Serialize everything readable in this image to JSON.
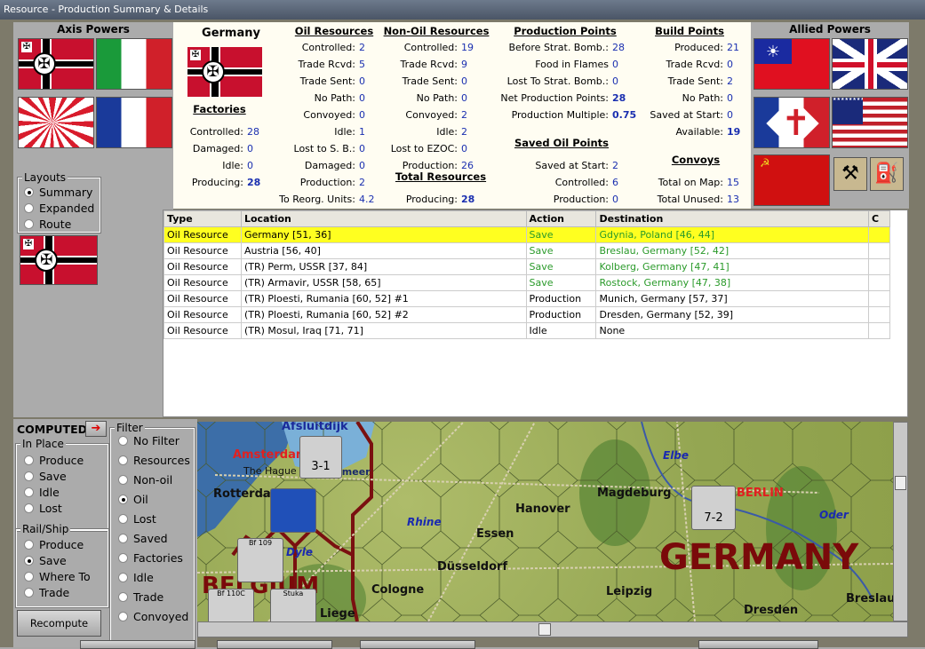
{
  "window": {
    "title": "Resource - Production Summary & Details"
  },
  "axis": {
    "title": "Axis Powers",
    "flags": [
      "germany",
      "italy",
      "japan",
      "vichy-france"
    ]
  },
  "allied": {
    "title": "Allied Powers",
    "flags": [
      "china",
      "united-kingdom",
      "free-france",
      "usa",
      "ussr",
      "resource-icons"
    ]
  },
  "layouts": {
    "title": "Layouts",
    "options": [
      "Summary",
      "Expanded",
      "Route"
    ],
    "selected": 0
  },
  "country": {
    "name": "Germany"
  },
  "stats": {
    "factories": {
      "header": "Factories",
      "items": [
        [
          "Controlled:",
          "28"
        ],
        [
          "Damaged:",
          "0"
        ],
        [
          "Idle:",
          "0"
        ],
        [
          "Producing:",
          "28"
        ]
      ]
    },
    "oil": {
      "header": "Oil Resources",
      "items": [
        [
          "Controlled:",
          "2"
        ],
        [
          "Trade Rcvd:",
          "5"
        ],
        [
          "Trade Sent:",
          "0"
        ],
        [
          "No Path:",
          "0"
        ],
        [
          "Convoyed:",
          "0"
        ],
        [
          "Idle:",
          "1"
        ],
        [
          "Lost to S. B.:",
          "0"
        ],
        [
          "Damaged:",
          "0"
        ],
        [
          "Production:",
          "2"
        ],
        [
          "To Reorg. Units:",
          "4.2"
        ]
      ]
    },
    "nonoil": {
      "header": "Non-Oil Resources",
      "items": [
        [
          "Controlled:",
          "19"
        ],
        [
          "Trade Rcvd:",
          "9"
        ],
        [
          "Trade Sent:",
          "0"
        ],
        [
          "No Path:",
          "0"
        ],
        [
          "Convoyed:",
          "2"
        ],
        [
          "Idle:",
          "2"
        ],
        [
          "Lost to EZOC:",
          "0"
        ],
        [
          "Production:",
          "26"
        ]
      ]
    },
    "total": {
      "header": "Total Resources",
      "items": [
        [
          "Producing:",
          "28"
        ]
      ]
    },
    "production": {
      "header": "Production Points",
      "items": [
        [
          "Before Strat. Bomb.:",
          "28"
        ],
        [
          "Food in Flames",
          "0"
        ],
        [
          "Lost To Strat. Bomb.:",
          "0"
        ],
        [
          "Net Production Points:",
          "28"
        ],
        [
          "Production Multiple:",
          "0.75"
        ]
      ]
    },
    "savedoil": {
      "header": "Saved Oil Points",
      "items": [
        [
          "Saved at Start:",
          "2"
        ],
        [
          "Controlled:",
          "6"
        ],
        [
          "Production:",
          "0"
        ]
      ]
    },
    "build": {
      "header": "Build Points",
      "items": [
        [
          "Produced:",
          "21"
        ],
        [
          "Trade Rcvd:",
          "0"
        ],
        [
          "Trade Sent:",
          "2"
        ],
        [
          "No Path:",
          "0"
        ],
        [
          "Saved at Start:",
          "0"
        ],
        [
          "Available:",
          "19"
        ]
      ]
    },
    "convoys": {
      "header": "Convoys",
      "items": [
        [
          "Total on Map:",
          "15"
        ],
        [
          "Total Unused:",
          "13"
        ]
      ]
    }
  },
  "table": {
    "columns": [
      "Type",
      "Location",
      "Action",
      "Destination",
      "C"
    ],
    "rows": [
      [
        "Oil Resource",
        "Germany [51, 36]",
        "Save",
        "Gdynia, Poland [46, 44]",
        ""
      ],
      [
        "Oil Resource",
        "Austria [56, 40]",
        "Save",
        "Breslau, Germany [52, 42]",
        ""
      ],
      [
        "Oil Resource",
        "(TR) Perm, USSR [37, 84]",
        "Save",
        "Kolberg, Germany [47, 41]",
        ""
      ],
      [
        "Oil Resource",
        "(TR) Armavir, USSR [58, 65]",
        "Save",
        "Rostock, Germany [47, 38]",
        ""
      ],
      [
        "Oil Resource",
        "(TR) Ploesti, Rumania [60, 52] #1",
        "Production",
        "Munich, Germany [57, 37]",
        ""
      ],
      [
        "Oil Resource",
        "(TR) Ploesti, Rumania [60, 52] #2",
        "Production",
        "Dresden, Germany [52, 39]",
        ""
      ],
      [
        "Oil Resource",
        "(TR) Mosul, Iraq [71, 71]",
        "Idle",
        "None",
        ""
      ]
    ],
    "selected": 0,
    "save_color": "#2a9a2a"
  },
  "computed": {
    "label": "COMPUTED"
  },
  "inplace": {
    "title": "In Place",
    "options": [
      "Produce",
      "Save",
      "Idle",
      "Lost"
    ]
  },
  "railship": {
    "title": "Rail/Ship",
    "options": [
      "Produce",
      "Save",
      "Where To",
      "Trade"
    ],
    "selected": 1
  },
  "filter": {
    "title": "Filter",
    "options": [
      "No Filter",
      "Resources",
      "Non-oil",
      "Oil",
      "Lost",
      "Saved",
      "Factories",
      "Idle",
      "Trade",
      "Convoyed"
    ],
    "selected": 3
  },
  "recompute": {
    "label": "Recompute"
  },
  "map": {
    "labels": {
      "afsluitdijk": "Afsluitdijk",
      "amsterdam": "Amsterdam",
      "hague": "The Hague",
      "ijsselmeer": "selmeer",
      "rotterdam": "Rotterda",
      "rhine": "Rhine",
      "essen": "Essen",
      "hanover": "Hanover",
      "magdeburg": "Magdeburg",
      "berlin": "BERLIN",
      "elbe": "Elbe",
      "oder": "Oder",
      "dyle": "Dyle",
      "dusseldorf": "Düsseldorf",
      "germany": "GERMANY",
      "belgium": "BELGIUM",
      "cologne": "Cologne",
      "leipzig": "Leipzig",
      "liege": "Liege",
      "dresden": "Dresden",
      "breslau": "Breslau"
    },
    "units": {
      "u1": "3-1",
      "u2": "7-2",
      "u3": "Bf 109",
      "u4": "Bf 110C",
      "u5": "Stuka"
    }
  }
}
